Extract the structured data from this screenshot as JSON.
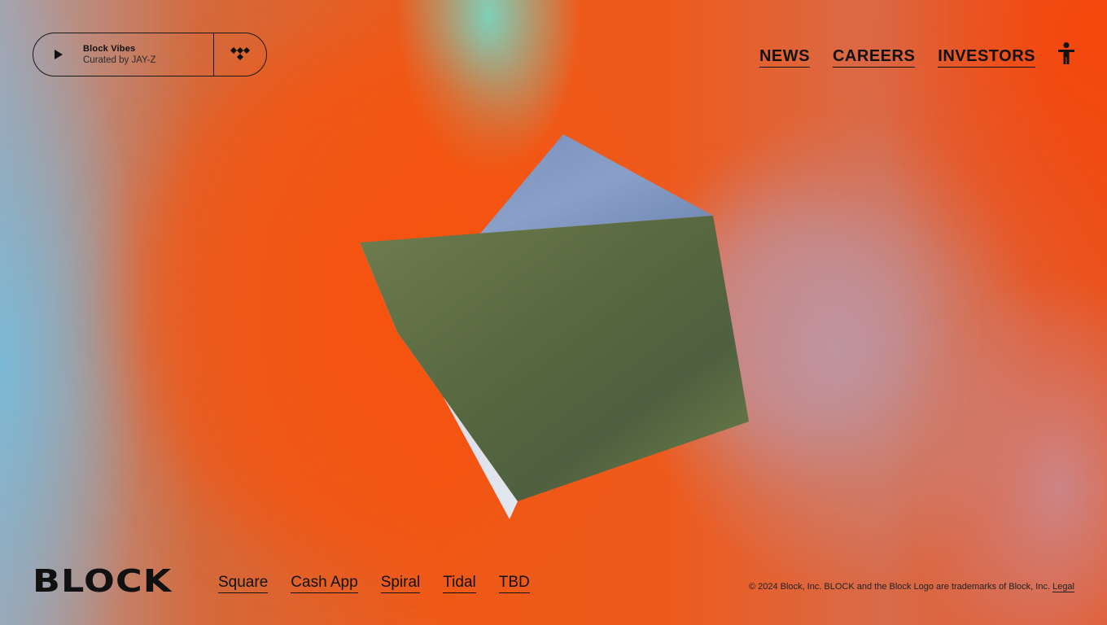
{
  "player": {
    "title": "Block Vibes",
    "subtitle": "Curated by JAY-Z",
    "play_icon": "play-icon",
    "service_icon": "tidal-icon"
  },
  "nav": {
    "items": [
      "NEWS",
      "CAREERS",
      "INVESTORS"
    ],
    "accessibility_icon": "accessibility-icon"
  },
  "footer": {
    "logo": "BLOCK",
    "brands": [
      "Square",
      "Cash App",
      "Spiral",
      "Tidal",
      "TBD"
    ],
    "copyright": "© 2024 Block, Inc. BLOCK and the Block Logo are trademarks of Block, Inc.",
    "legal_link": "Legal"
  },
  "colors": {
    "background_orange": "#ef5a18",
    "text": "#111111",
    "shape_green": "#5f7047",
    "shape_blue": "#8296bd"
  }
}
